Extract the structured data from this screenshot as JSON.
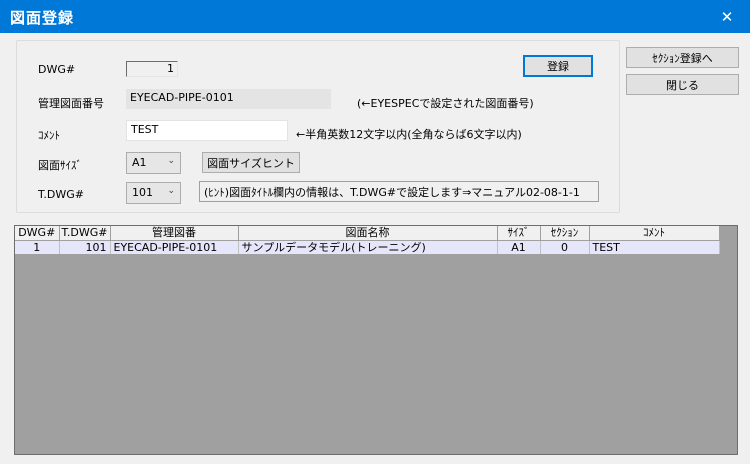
{
  "window": {
    "title": "図面登録",
    "close_glyph": "✕"
  },
  "form": {
    "dwg_label": "DWG#",
    "dwg_value": "1",
    "mgmt_label": "管理図面番号",
    "mgmt_value": "EYECAD-PIPE-0101",
    "mgmt_note": "(←EYESPECで設定された図面番号)",
    "comment_label": "ｺﾒﾝﾄ",
    "comment_value": "TEST",
    "comment_note": "←半角英数12文字以内(全角ならば6文字以内)",
    "size_label": "図面ｻｲｽﾞ",
    "size_value": "A1",
    "size_hint_button": "図面サイズヒント",
    "tdwg_label": "T.DWG#",
    "tdwg_value": "101",
    "hint_text": "(ﾋﾝﾄ)図面ﾀｲﾄﾙ欄内の情報は、T.DWG#で設定します⇒マニュアル02-08-1-1",
    "register_button": "登録"
  },
  "side": {
    "section_button": "ｾｸｼｮﾝ登録へ",
    "close_button": "閉じる"
  },
  "grid": {
    "columns": [
      "DWG#",
      "T.DWG#",
      "管理図番",
      "図面名称",
      "ｻｲｽﾞ",
      "ｾｸｼｮﾝ",
      "ｺﾒﾝﾄ"
    ],
    "rows": [
      {
        "dwg": "1",
        "tdwg": "101",
        "mgmt": "EYECAD-PIPE-0101",
        "name": "サンプルデータモデル(トレーニング)",
        "size": "A1",
        "section": "0",
        "comment": "TEST"
      }
    ]
  }
}
